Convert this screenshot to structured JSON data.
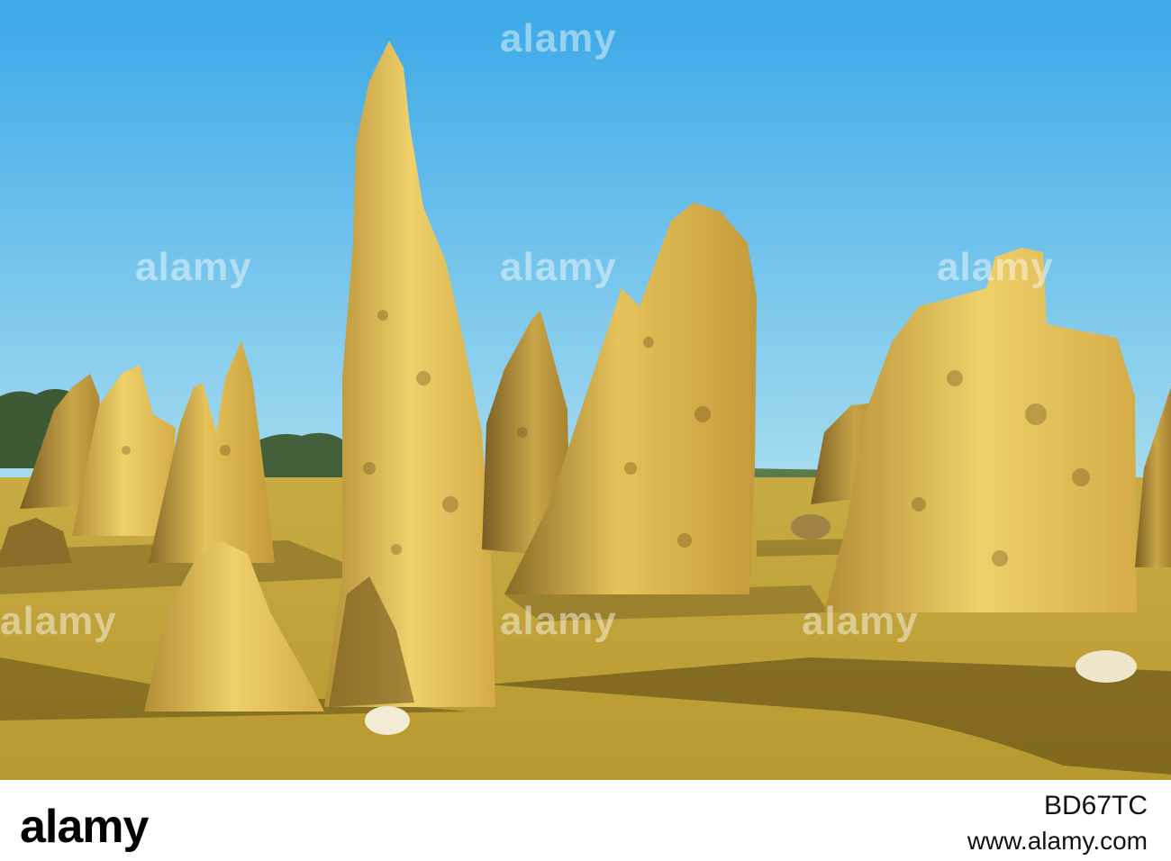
{
  "scene": {
    "subject": "limestone pinnacles in yellow desert sand",
    "colors": {
      "sky_top": "#3aa8e8",
      "sky_bottom": "#9fd8ef",
      "sand": "#c4a53a",
      "sand_shadow": "#6e5a1e",
      "rock_lit": "#e8c45a",
      "rock_shade": "#8a6a26",
      "vegetation": "#3e5a34"
    }
  },
  "watermark": {
    "text": "alamy"
  },
  "footer": {
    "brand": "alamy",
    "image_id": "BD67TC",
    "url": "www.alamy.com"
  }
}
